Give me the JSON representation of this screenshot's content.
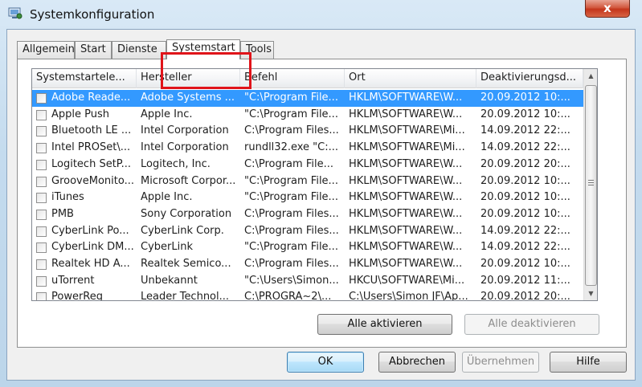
{
  "window": {
    "title": "Systemkonfiguration",
    "close_label": "x"
  },
  "tabs": [
    "Allgemein",
    "Start",
    "Dienste",
    "Systemstart",
    "Tools"
  ],
  "active_tab": "Systemstart",
  "table": {
    "columns": [
      "Systemstartele...",
      "Hersteller",
      "Befehl",
      "Ort",
      "Deaktivierungsd..."
    ],
    "rows": [
      {
        "checked": false,
        "selected": true,
        "cells": [
          "Adobe Reade...",
          "Adobe Systems ...",
          "\"C:\\Program File...",
          "HKLM\\SOFTWARE\\W...",
          "20.09.2012 10:..."
        ]
      },
      {
        "checked": false,
        "selected": false,
        "cells": [
          "Apple Push",
          "Apple Inc.",
          "\"C:\\Program File...",
          "HKLM\\SOFTWARE\\W...",
          "20.09.2012 10:..."
        ]
      },
      {
        "checked": false,
        "selected": false,
        "cells": [
          "Bluetooth LE ...",
          "Intel Corporation",
          "C:\\Program Files...",
          "HKLM\\SOFTWARE\\Mi...",
          "14.09.2012 22:..."
        ]
      },
      {
        "checked": false,
        "selected": false,
        "cells": [
          "Intel PROSet\\...",
          "Intel Corporation",
          "rundll32.exe \"C:...",
          "HKLM\\SOFTWARE\\Mi...",
          "14.09.2012 22:..."
        ]
      },
      {
        "checked": false,
        "selected": false,
        "cells": [
          "Logitech SetP...",
          "Logitech, Inc.",
          "C:\\Program File...",
          "HKLM\\SOFTWARE\\W...",
          "20.09.2012 20:..."
        ]
      },
      {
        "checked": false,
        "selected": false,
        "cells": [
          "GrooveMonito...",
          "Microsoft Corpor...",
          "\"C:\\Program File...",
          "HKLM\\SOFTWARE\\W...",
          "20.09.2012 10:..."
        ]
      },
      {
        "checked": false,
        "selected": false,
        "cells": [
          "iTunes",
          "Apple Inc.",
          "\"C:\\Program File...",
          "HKLM\\SOFTWARE\\W...",
          "20.09.2012 10:..."
        ]
      },
      {
        "checked": false,
        "selected": false,
        "cells": [
          "PMB",
          "Sony Corporation",
          "C:\\Program Files...",
          "HKLM\\SOFTWARE\\W...",
          "20.09.2012 10:..."
        ]
      },
      {
        "checked": false,
        "selected": false,
        "cells": [
          "CyberLink Po...",
          "CyberLink Corp.",
          "C:\\Program Files...",
          "HKLM\\SOFTWARE\\W...",
          "14.09.2012 22:..."
        ]
      },
      {
        "checked": false,
        "selected": false,
        "cells": [
          "CyberLink DM...",
          "CyberLink",
          "\"C:\\Program File...",
          "HKLM\\SOFTWARE\\W...",
          "14.09.2012 22:..."
        ]
      },
      {
        "checked": false,
        "selected": false,
        "cells": [
          "Realtek HD A...",
          "Realtek Semico...",
          "C:\\Program Files...",
          "HKLM\\SOFTWARE\\W...",
          "20.09.2012 10:..."
        ]
      },
      {
        "checked": false,
        "selected": false,
        "cells": [
          "uTorrent",
          "Unbekannt",
          "\"C:\\Users\\Simon...",
          "HKCU\\SOFTWARE\\Mi...",
          "20.09.2012 11:..."
        ]
      },
      {
        "checked": false,
        "selected": false,
        "cells": [
          "PowerReg",
          "Leader Technol...",
          "C:\\PROGRA~2\\...",
          "C:\\Users\\Simon JF\\Ap...",
          "20.09.2012 20:..."
        ]
      }
    ]
  },
  "buttons": {
    "enable_all": "Alle aktivieren",
    "disable_all": "Alle deaktivieren",
    "ok": "OK",
    "cancel": "Abbrechen",
    "apply": "Übernehmen",
    "help": "Hilfe"
  },
  "colors": {
    "selection": "#3399ff",
    "highlight_box": "#e0141a",
    "close_button": "#c4351b"
  },
  "icons": {
    "window": "msconfig-window-icon",
    "close": "close-icon",
    "scroll_up": "scroll-up-arrow-icon",
    "scroll_down": "scroll-down-arrow-icon"
  }
}
